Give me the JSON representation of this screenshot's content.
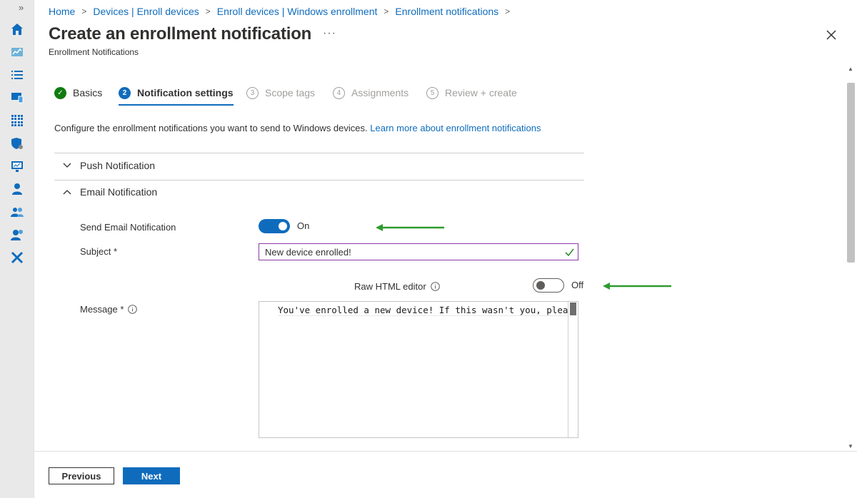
{
  "rail": {
    "expand_glyph": "»",
    "icons": [
      "home-icon",
      "dashboard-icon",
      "all-services-icon",
      "devices-icon",
      "apps-icon",
      "endpoint-security-icon",
      "reports-icon",
      "users-icon",
      "groups-icon",
      "tenant-admin-icon",
      "troubleshooting-icon"
    ]
  },
  "breadcrumb": [
    "Home",
    "Devices | Enroll devices",
    "Enroll devices | Windows enrollment",
    "Enrollment notifications"
  ],
  "header": {
    "title": "Create an enrollment notification",
    "more": "···",
    "subtitle": "Enrollment Notifications"
  },
  "tabs": [
    {
      "num": "✓",
      "label": "Basics",
      "state": "done"
    },
    {
      "num": "2",
      "label": "Notification settings",
      "state": "active"
    },
    {
      "num": "3",
      "label": "Scope tags",
      "state": "inactive"
    },
    {
      "num": "4",
      "label": "Assignments",
      "state": "inactive"
    },
    {
      "num": "5",
      "label": "Review + create",
      "state": "inactive"
    }
  ],
  "intro": {
    "text": "Configure the enrollment notifications you want to send to Windows devices.",
    "link": "Learn more about enrollment notifications"
  },
  "sections": {
    "push": "Push Notification",
    "email": "Email Notification"
  },
  "form": {
    "send_email_label": "Send Email Notification",
    "send_email_state": "On",
    "subject_label": "Subject *",
    "subject_value": "New device enrolled!",
    "raw_html_label": "Raw HTML editor",
    "raw_html_state": "Off",
    "message_label": "Message *",
    "message_value": "You've enrolled a new device! If this wasn't you, please"
  },
  "footer": {
    "previous": "Previous",
    "next": "Next"
  },
  "colors": {
    "accent": "#0f6cbd",
    "success": "#107c10",
    "annotation_arrow": "#2e9b2e",
    "subject_border": "#8a3aa6"
  }
}
